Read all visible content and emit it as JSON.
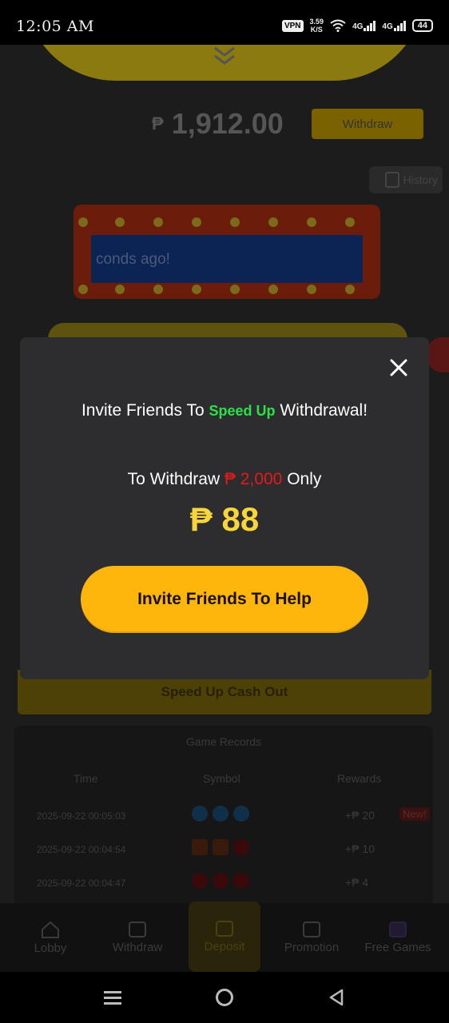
{
  "status_bar": {
    "time": "12:05 AM",
    "vpn": "VPN",
    "net_speed_value": "3.59",
    "net_speed_unit": "K/S",
    "sim1": "4G",
    "sim2": "4G",
    "battery": "44"
  },
  "background": {
    "balance_currency": "₱",
    "balance": "1,912.00",
    "withdraw_label": "Withdraw",
    "history_label": "History",
    "marquee_text": "conds ago!",
    "speed_up_label": "Speed Up Cash Out",
    "records": {
      "title": "Game Records",
      "headers": [
        "Time",
        "Symbol",
        "Rewards"
      ],
      "rows": [
        {
          "time": "2025-09-22 00:05:03",
          "symbol": "blue-coins",
          "reward": "+₱ 20",
          "badge": "New!"
        },
        {
          "time": "2025-09-22 00:04:54",
          "symbol": "seven-cherry",
          "reward": "+₱ 10",
          "badge": ""
        },
        {
          "time": "2025-09-22 00:04:47",
          "symbol": "cherries",
          "reward": "+₱ 4",
          "badge": ""
        }
      ]
    }
  },
  "bottom_nav": {
    "items": [
      {
        "label": "Lobby",
        "icon": "home-icon"
      },
      {
        "label": "Withdraw",
        "icon": "wallet-icon"
      },
      {
        "label": "Deposit",
        "icon": "deposit-wallet-icon"
      },
      {
        "label": "Promotion",
        "icon": "gift-icon"
      },
      {
        "label": "Free Games",
        "icon": "free-games-icon"
      }
    ]
  },
  "modal": {
    "title_prefix": "Invite Friends To ",
    "title_highlight": "Speed Up",
    "title_suffix": " Withdrawal!",
    "sub_prefix": "To Withdraw ",
    "sub_amount": "₱ 2,000",
    "sub_suffix": " Only",
    "amount": "₱ 88",
    "button_label": "Invite Friends To Help"
  },
  "colors": {
    "accent": "#ffb60c",
    "highlight_green": "#2de04a",
    "amount_yellow": "#f8d53a",
    "red": "#e51a1a",
    "modal_bg": "#2d2d2f"
  }
}
